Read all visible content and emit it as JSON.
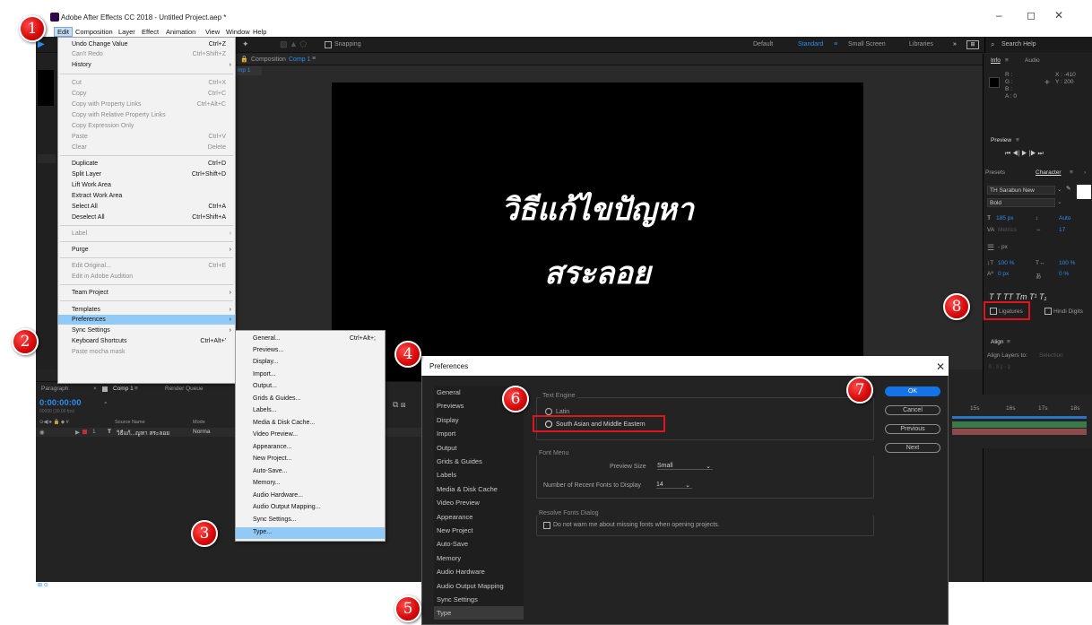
{
  "window": {
    "title": "Adobe After Effects CC 2018 - Untitled Project.aep *",
    "minimize": "–",
    "restore": "◻",
    "close": "✕"
  },
  "menubar": [
    "Edit",
    "Composition",
    "Layer",
    "Effect",
    "Animation",
    "View",
    "Window",
    "Help"
  ],
  "toolbar": {
    "snapping": "Snapping",
    "workspaces": [
      "Default",
      "Standard",
      "Small Screen",
      "Libraries"
    ],
    "active_workspace": "Standard",
    "more": "»",
    "search_placeholder": "Search Help"
  },
  "composition": {
    "tab_label": "Composition",
    "comp_name": "Comp 1",
    "sub_tab": "mp 1",
    "text_line1": "วิธีแก้ไขปัญหา",
    "text_line2": "สระลอย"
  },
  "edit_menu": [
    {
      "label": "Undo Change Value",
      "shortcut": "Ctrl+Z",
      "disabled": false
    },
    {
      "label": "Can't Redo",
      "shortcut": "Ctrl+Shift+Z",
      "disabled": true
    },
    {
      "label": "History",
      "submenu": true,
      "disabled": false
    },
    {
      "sep": true
    },
    {
      "label": "Cut",
      "shortcut": "Ctrl+X",
      "disabled": true
    },
    {
      "label": "Copy",
      "shortcut": "Ctrl+C",
      "disabled": true
    },
    {
      "label": "Copy with Property Links",
      "shortcut": "Ctrl+Alt+C",
      "disabled": true
    },
    {
      "label": "Copy with Relative Property Links",
      "disabled": true
    },
    {
      "label": "Copy Expression Only",
      "disabled": true
    },
    {
      "label": "Paste",
      "shortcut": "Ctrl+V",
      "disabled": true
    },
    {
      "label": "Clear",
      "shortcut": "Delete",
      "disabled": true
    },
    {
      "sep": true
    },
    {
      "label": "Duplicate",
      "shortcut": "Ctrl+D",
      "disabled": false
    },
    {
      "label": "Split Layer",
      "shortcut": "Ctrl+Shift+D",
      "disabled": false
    },
    {
      "label": "Lift Work Area",
      "disabled": false
    },
    {
      "label": "Extract Work Area",
      "disabled": false
    },
    {
      "label": "Select All",
      "shortcut": "Ctrl+A",
      "disabled": false
    },
    {
      "label": "Deselect All",
      "shortcut": "Ctrl+Shift+A",
      "disabled": false
    },
    {
      "sep": true
    },
    {
      "label": "Label",
      "submenu": true,
      "disabled": true
    },
    {
      "sep": true
    },
    {
      "label": "Purge",
      "submenu": true,
      "disabled": false
    },
    {
      "sep": true
    },
    {
      "label": "Edit Original...",
      "shortcut": "Ctrl+E",
      "disabled": true
    },
    {
      "label": "Edit in Adobe Audition",
      "disabled": true
    },
    {
      "sep": true
    },
    {
      "label": "Team Project",
      "submenu": true,
      "disabled": false
    },
    {
      "sep": true
    },
    {
      "label": "Templates",
      "submenu": true,
      "disabled": false
    },
    {
      "label": "Preferences",
      "submenu": true,
      "disabled": false,
      "highlight": true
    },
    {
      "label": "Sync Settings",
      "submenu": true,
      "disabled": false
    },
    {
      "label": "Keyboard Shortcuts",
      "shortcut": "Ctrl+Alt+'",
      "disabled": false
    },
    {
      "label": "Paste mocha mask",
      "disabled": true
    }
  ],
  "pref_menu": [
    {
      "label": "General...",
      "shortcut": "Ctrl+Alt+;"
    },
    {
      "label": "Previews..."
    },
    {
      "label": "Display..."
    },
    {
      "label": "Import..."
    },
    {
      "label": "Output..."
    },
    {
      "label": "Grids & Guides..."
    },
    {
      "label": "Labels..."
    },
    {
      "label": "Media & Disk Cache..."
    },
    {
      "label": "Video Preview..."
    },
    {
      "label": "Appearance..."
    },
    {
      "label": "New Project..."
    },
    {
      "label": "Auto-Save..."
    },
    {
      "label": "Memory..."
    },
    {
      "label": "Audio Hardware..."
    },
    {
      "label": "Audio Output Mapping..."
    },
    {
      "label": "Sync Settings..."
    },
    {
      "label": "Type...",
      "highlight": true
    }
  ],
  "dialog": {
    "title": "Preferences",
    "sidebar": [
      "General",
      "Previews",
      "Display",
      "Import",
      "Output",
      "Grids & Guides",
      "Labels",
      "Media & Disk Cache",
      "Video Preview",
      "Appearance",
      "New Project",
      "Auto-Save",
      "Memory",
      "Audio Hardware",
      "Audio Output Mapping",
      "Sync Settings",
      "Type"
    ],
    "selected": "Type",
    "text_engine": {
      "title": "Text Engine",
      "opt1": "Latin",
      "opt2": "South Asian and Middle Eastern"
    },
    "font_menu": {
      "title": "Font Menu",
      "preview_label": "Preview Size",
      "preview_value": "Small",
      "recent_label": "Number of Recent Fonts to Display",
      "recent_value": "14"
    },
    "resolve": {
      "title": "Resolve Fonts Dialog",
      "checkbox_label": "Do not warn me about missing fonts when opening projects."
    },
    "buttons": {
      "ok": "OK",
      "cancel": "Cancel",
      "previous": "Previous",
      "next": "Next"
    }
  },
  "right_panel": {
    "info_tab": "Info",
    "audio_tab": "Audio",
    "r": "R :",
    "g": "G :",
    "b": "B :",
    "a": "A : 0",
    "x": "X : -410",
    "y": "Y : 200",
    "preview_tab": "Preview",
    "presets_tab": "Presets",
    "character_tab": "Character",
    "font": "TH Sarabun New",
    "style": "Bold",
    "size": "185 px",
    "leading": "Auto",
    "kerning": "Metrics",
    "tracking": "17",
    "stroke": "- px",
    "vscale": "100 %",
    "hscale": "100 %",
    "baseline": "0 px",
    "tsume": "0 %",
    "ligatures": "Ligatures",
    "hindi": "Hindi Digits",
    "align_tab": "Align",
    "align_to_label": "Align Layers to:",
    "align_to_value": "Selection"
  },
  "timeline": {
    "paragraph_tab": "Paragraph",
    "comp_tab": "Comp 1",
    "render_tab": "Render Queue",
    "timecode": "0:00:00:00",
    "fps": "00000 (30.00 fps)",
    "col_source": "Source Name",
    "col_mode": "Mode",
    "layer_num": "1",
    "layer_name": "วิธีแก้...ญหา สระลอย",
    "layer_mode": "Norma",
    "ruler": [
      "15s",
      "16s",
      "17s",
      "18s"
    ]
  },
  "steps": [
    "1",
    "2",
    "3",
    "4",
    "5",
    "6",
    "7",
    "8"
  ]
}
